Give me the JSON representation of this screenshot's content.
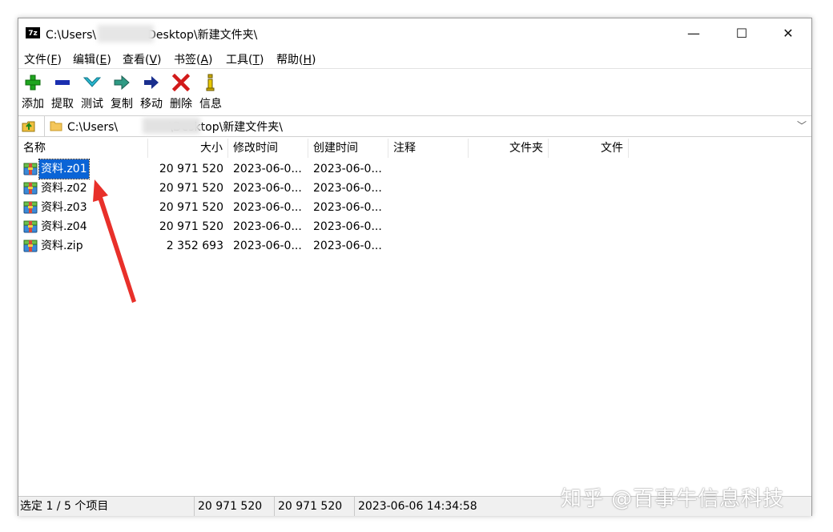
{
  "window": {
    "title_prefix": "C:\\Users\\",
    "title_suffix": "Desktop\\新建文件夹\\",
    "icon_text": "7z",
    "controls": {
      "minimize": "—",
      "maximize": "☐",
      "close": "✕"
    }
  },
  "menu": [
    {
      "label": "文件(",
      "key": "F",
      "end": ")"
    },
    {
      "label": "编辑(",
      "key": "E",
      "end": ")"
    },
    {
      "label": "查看(",
      "key": "V",
      "end": ")"
    },
    {
      "label": "书签(",
      "key": "A",
      "end": ")"
    },
    {
      "label": "工具(",
      "key": "T",
      "end": ")"
    },
    {
      "label": "帮助(",
      "key": "H",
      "end": ")"
    }
  ],
  "toolbar": [
    {
      "label": "添加",
      "icon": "plus-icon",
      "color": "#1fa51f"
    },
    {
      "label": "提取",
      "icon": "minus-icon",
      "color": "#1a2fb0"
    },
    {
      "label": "测试",
      "icon": "check-chevron-icon",
      "color": "#27b6cf"
    },
    {
      "label": "复制",
      "icon": "copy-arrow-icon",
      "color": "#2f9a84"
    },
    {
      "label": "移动",
      "icon": "move-arrow-icon",
      "color": "#1a2f8e"
    },
    {
      "label": "删除",
      "icon": "delete-x-icon",
      "color": "#d21a1a"
    },
    {
      "label": "信息",
      "icon": "info-icon",
      "color": "#c8a800"
    }
  ],
  "address": {
    "prefix": "C:\\Users\\",
    "suffix": "\\Desktop\\新建文件夹\\",
    "dropdown": "﹀"
  },
  "columns": [
    "名称",
    "大小",
    "修改时间",
    "创建时间",
    "注释",
    "文件夹",
    "文件"
  ],
  "files": [
    {
      "name": "资料.z01",
      "size": "20 971 520",
      "modified": "2023-06-0...",
      "created": "2023-06-0...",
      "selected": true
    },
    {
      "name": "资料.z02",
      "size": "20 971 520",
      "modified": "2023-06-0...",
      "created": "2023-06-0...",
      "selected": false
    },
    {
      "name": "资料.z03",
      "size": "20 971 520",
      "modified": "2023-06-0...",
      "created": "2023-06-0...",
      "selected": false
    },
    {
      "name": "资料.z04",
      "size": "20 971 520",
      "modified": "2023-06-0...",
      "created": "2023-06-0...",
      "selected": false
    },
    {
      "name": "资料.zip",
      "size": "2 352 693",
      "modified": "2023-06-0...",
      "created": "2023-06-0...",
      "selected": false
    }
  ],
  "status": {
    "selection": "选定 1 / 5 个项目",
    "size": "20 971 520",
    "packed": "20 971 520",
    "datetime": "2023-06-06 14:34:58"
  },
  "watermark": "知乎 @百事牛信息科技",
  "annotation_arrow_color": "#e8302a"
}
